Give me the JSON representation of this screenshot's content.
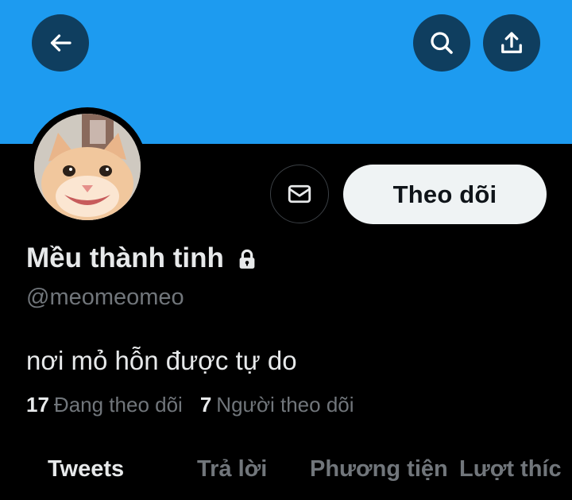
{
  "header": {
    "back_icon": "arrow-left-icon",
    "search_icon": "search-icon",
    "share_icon": "share-upload-icon",
    "banner_color": "#1d9bf0"
  },
  "profile": {
    "avatar_alt": "cat-avatar",
    "message_icon": "envelope-icon",
    "follow_label": "Theo dõi",
    "display_name": "Mều thành tinh",
    "protected_icon": "lock-icon",
    "handle": "@meomeomeo",
    "bio": "nơi mỏ hỗn được tự do",
    "following_count": "17",
    "following_label": "Đang theo dõi",
    "followers_count": "7",
    "followers_label": "Người theo dõi"
  },
  "tabs": [
    {
      "label": "Tweets",
      "active": true
    },
    {
      "label": "Trả lời",
      "active": false
    },
    {
      "label": "Phương tiện",
      "active": false
    },
    {
      "label": "Lượt thíc",
      "active": false
    }
  ]
}
